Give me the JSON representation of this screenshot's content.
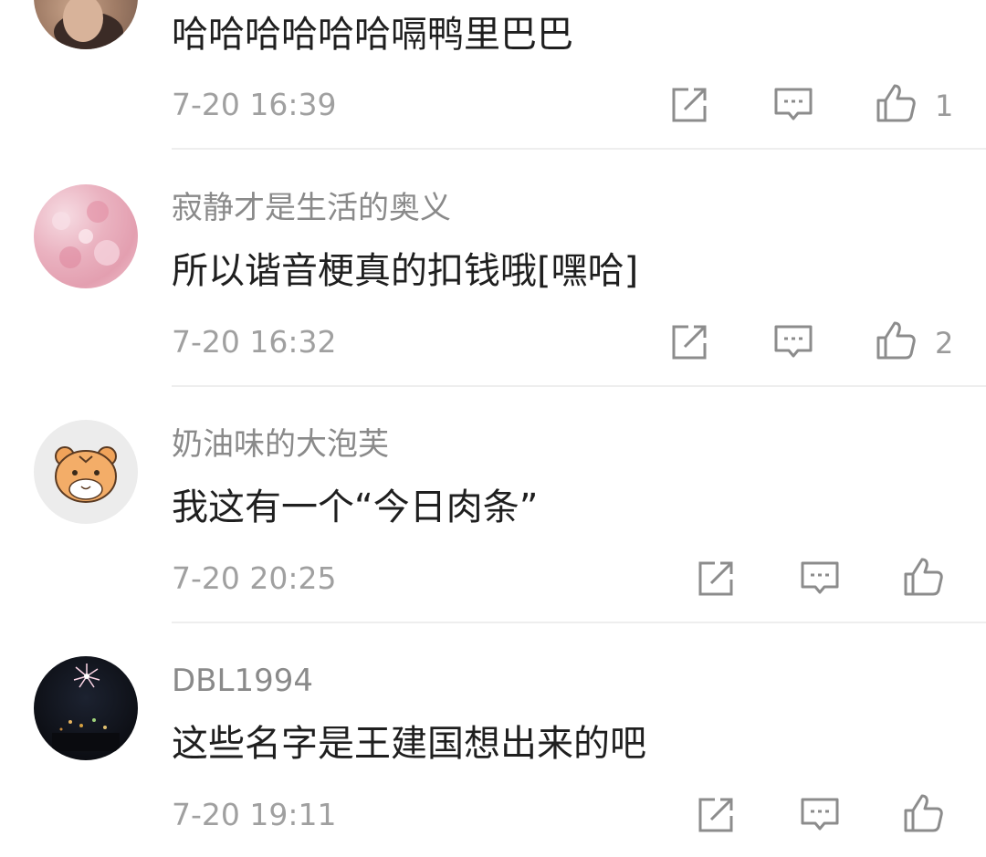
{
  "comments": [
    {
      "avatar": "avatar-woman-photo",
      "username": "",
      "text": "哈哈哈哈哈哈嗝鸭里巴巴",
      "time": "7-20 16:39",
      "likes": "1"
    },
    {
      "avatar": "avatar-pink-blossom",
      "username": "寂静才是生活的奥义",
      "text": "所以谐音梗真的扣钱哦[嘿哈]",
      "time": "7-20 16:32",
      "likes": "2"
    },
    {
      "avatar": "avatar-tiger-cartoon",
      "username": "奶油味的大泡芙",
      "text": "我这有一个“今日肉条”",
      "time": "7-20 20:25",
      "likes": ""
    },
    {
      "avatar": "avatar-night-fireworks",
      "username": "DBL1994",
      "text": "这些名字是王建国想出来的吧",
      "time": "7-20 19:11",
      "likes": ""
    }
  ],
  "icons": {
    "share": "share-icon",
    "reply": "reply-icon",
    "like": "thumbs-up-icon"
  },
  "colors": {
    "text": "#1f1f1f",
    "username": "#8a8a8a",
    "meta": "#a0a0a0",
    "icon": "#8c8c8c",
    "divider": "#eeeeee"
  }
}
